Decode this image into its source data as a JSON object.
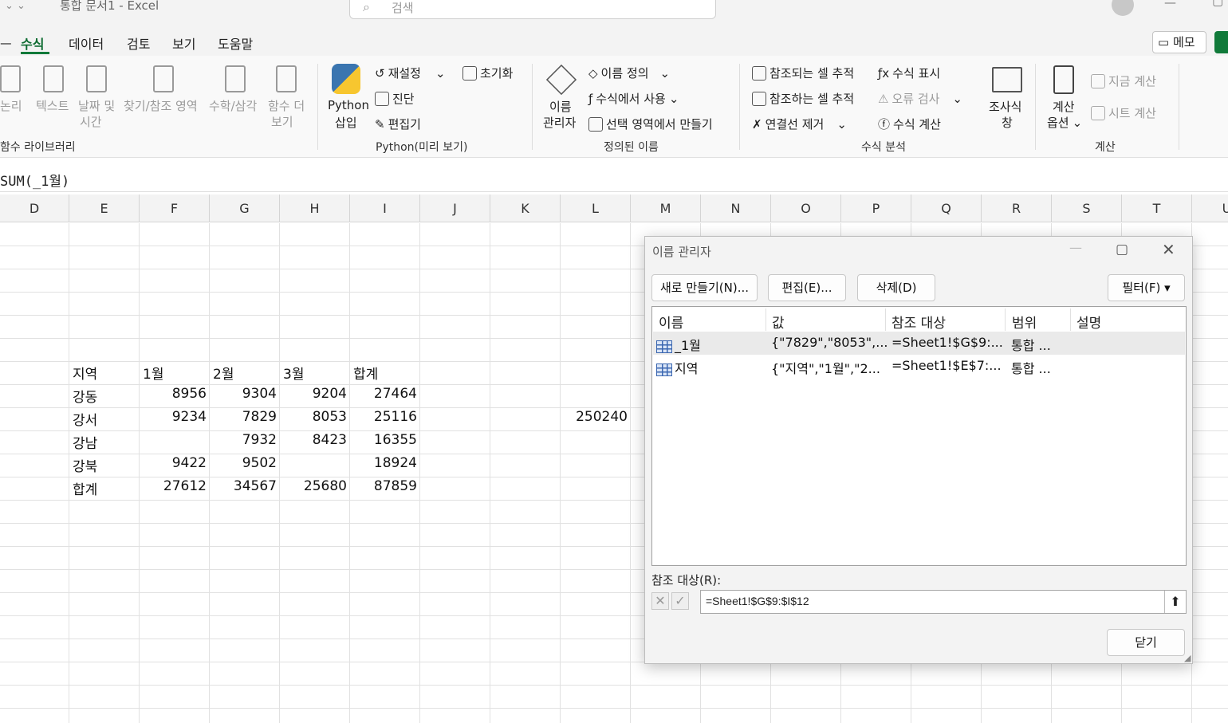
{
  "titlebar": {
    "doc_title": "통합 문서1 - Excel",
    "search_placeholder": "검색"
  },
  "tabs": [
    {
      "label": "수식"
    },
    {
      "label": "데이터"
    },
    {
      "label": "검토"
    },
    {
      "label": "보기"
    },
    {
      "label": "도움말"
    }
  ],
  "memo_label": "메모",
  "ribbon": {
    "lib": {
      "logic": "논리",
      "text": "텍스트",
      "datetime1": "날짜 및",
      "datetime2": "시간",
      "lookup": "찾기/참조 영역",
      "math": "수학/삼각",
      "more1": "함수 더",
      "more2": "보기",
      "group": "함수 라이브러리"
    },
    "python": {
      "insert1": "Python",
      "insert2": "삽입",
      "reset": "재설정",
      "init": "초기화",
      "diag": "진단",
      "editor": "편집기",
      "group": "Python(미리 보기)"
    },
    "names": {
      "manager1": "이름",
      "manager2": "관리자",
      "define": "이름 정의",
      "use": "수식에서 사용",
      "create": "선택 영역에서 만들기",
      "group": "정의된 이름"
    },
    "audit": {
      "precedents": "참조되는 셀 추적",
      "show": "수식 표시",
      "dependents": "참조하는 셀 추적",
      "error": "오류 검사",
      "remove": "연결선 제거",
      "evaluate": "수식 계산",
      "watch1": "조사식",
      "watch2": "창",
      "group": "수식 분석"
    },
    "calc": {
      "opt1": "계산",
      "opt2": "옵션",
      "now": "지금 계산",
      "sheet": "시트 계산",
      "group": "계산"
    }
  },
  "formula_bar": {
    "text": "SUM(_1월)"
  },
  "columns": [
    "D",
    "E",
    "F",
    "G",
    "H",
    "I",
    "J",
    "K",
    "L",
    "M",
    "N",
    "O",
    "P",
    "Q",
    "R",
    "S",
    "T",
    "U"
  ],
  "sheet": {
    "rows": [
      [
        "지역",
        "1월",
        "2월",
        "3월",
        "합계"
      ],
      [
        "강동",
        "8956",
        "9304",
        "9204",
        "27464"
      ],
      [
        "강서",
        "9234",
        "7829",
        "8053",
        "25116"
      ],
      [
        "강남",
        "",
        "7932",
        "8423",
        "16355"
      ],
      [
        "강북",
        "9422",
        "9502",
        "",
        "18924"
      ],
      [
        "합계",
        "27612",
        "34567",
        "25680",
        "87859"
      ]
    ],
    "l_cell": "250240"
  },
  "dialog": {
    "title": "이름 관리자",
    "new_button": "새로 만들기(N)...",
    "edit_button": "편집(E)...",
    "delete_button": "삭제(D)",
    "filter_button": "필터(F)",
    "headers": [
      "이름",
      "값",
      "참조 대상",
      "범위",
      "설명"
    ],
    "names": [
      {
        "name": "_1월",
        "value": "{\"7829\",\"8053\",...",
        "refers": "=Sheet1!$G$9:...",
        "scope": "통합 ...",
        "comment": ""
      },
      {
        "name": "지역",
        "value": "{\"지역\",\"1월\",\"2...",
        "refers": "=Sheet1!$E$7:...",
        "scope": "통합 ...",
        "comment": ""
      }
    ],
    "refers_label": "참조 대상(R):",
    "refers_value": "=Sheet1!$G$9:$I$12",
    "close_button": "닫기"
  }
}
